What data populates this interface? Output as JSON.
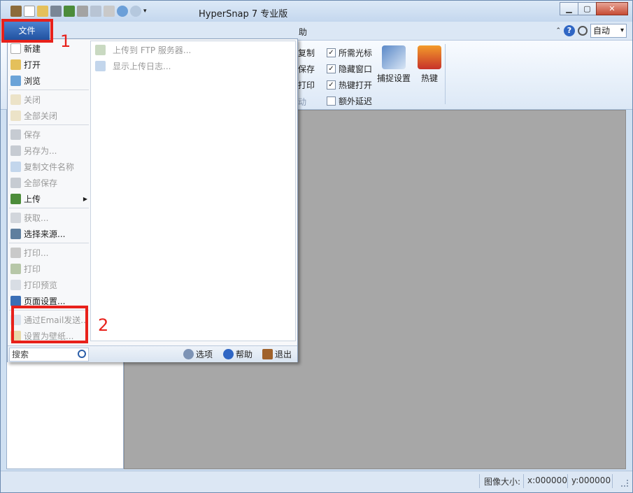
{
  "window": {
    "title": "HyperSnap 7 专业版",
    "minimize": "▁",
    "maximize": "▢",
    "close": "✕"
  },
  "ribbon": {
    "file_tab": "文件",
    "partial_tab": "助",
    "zoom_value": "自动",
    "help_icon": "?",
    "partial_buttons": [
      "复制",
      "保存",
      "打印",
      "动"
    ],
    "checkboxes": [
      {
        "label": "所需光标",
        "checked": true
      },
      {
        "label": "隐藏窗口",
        "checked": true
      },
      {
        "label": "热键打开",
        "checked": true
      },
      {
        "label": "额外延迟",
        "checked": false
      }
    ],
    "capture_settings": "捕捉设置",
    "hotkeys": "热键"
  },
  "file_menu": {
    "items": [
      {
        "label": "新建",
        "disabled": false
      },
      {
        "label": "打开",
        "disabled": false
      },
      {
        "label": "浏览",
        "disabled": false
      },
      {
        "label": "关闭",
        "disabled": true
      },
      {
        "label": "全部关闭",
        "disabled": true
      },
      {
        "label": "保存",
        "disabled": true
      },
      {
        "label": "另存为...",
        "disabled": true
      },
      {
        "label": "复制文件名称",
        "disabled": true
      },
      {
        "label": "全部保存",
        "disabled": true
      },
      {
        "label": "上传",
        "disabled": false
      },
      {
        "label": "获取...",
        "disabled": true
      },
      {
        "label": "选择来源...",
        "disabled": false
      },
      {
        "label": "打印...",
        "disabled": true
      },
      {
        "label": "打印",
        "disabled": true
      },
      {
        "label": "打印预览",
        "disabled": true
      },
      {
        "label": "页面设置...",
        "disabled": false
      },
      {
        "label": "通过Email发送...",
        "disabled": true
      },
      {
        "label": "设置为壁纸...",
        "disabled": true
      }
    ],
    "submenu": [
      {
        "label": "上传到 FTP 服务器...",
        "disabled": true
      },
      {
        "label": "显示上传日志...",
        "disabled": true
      }
    ],
    "search_label": "搜索",
    "options_label": "选项",
    "help_label": "帮助",
    "exit_label": "退出"
  },
  "status": {
    "image_size_label": "图像大小:",
    "x": "x:000000",
    "y": "y:000000"
  },
  "annotations": {
    "one": "1",
    "two": "2"
  },
  "colors": {
    "accent": "#2f66c4",
    "annotation_red": "#e8211b",
    "workspace": "#a7a7a7"
  }
}
